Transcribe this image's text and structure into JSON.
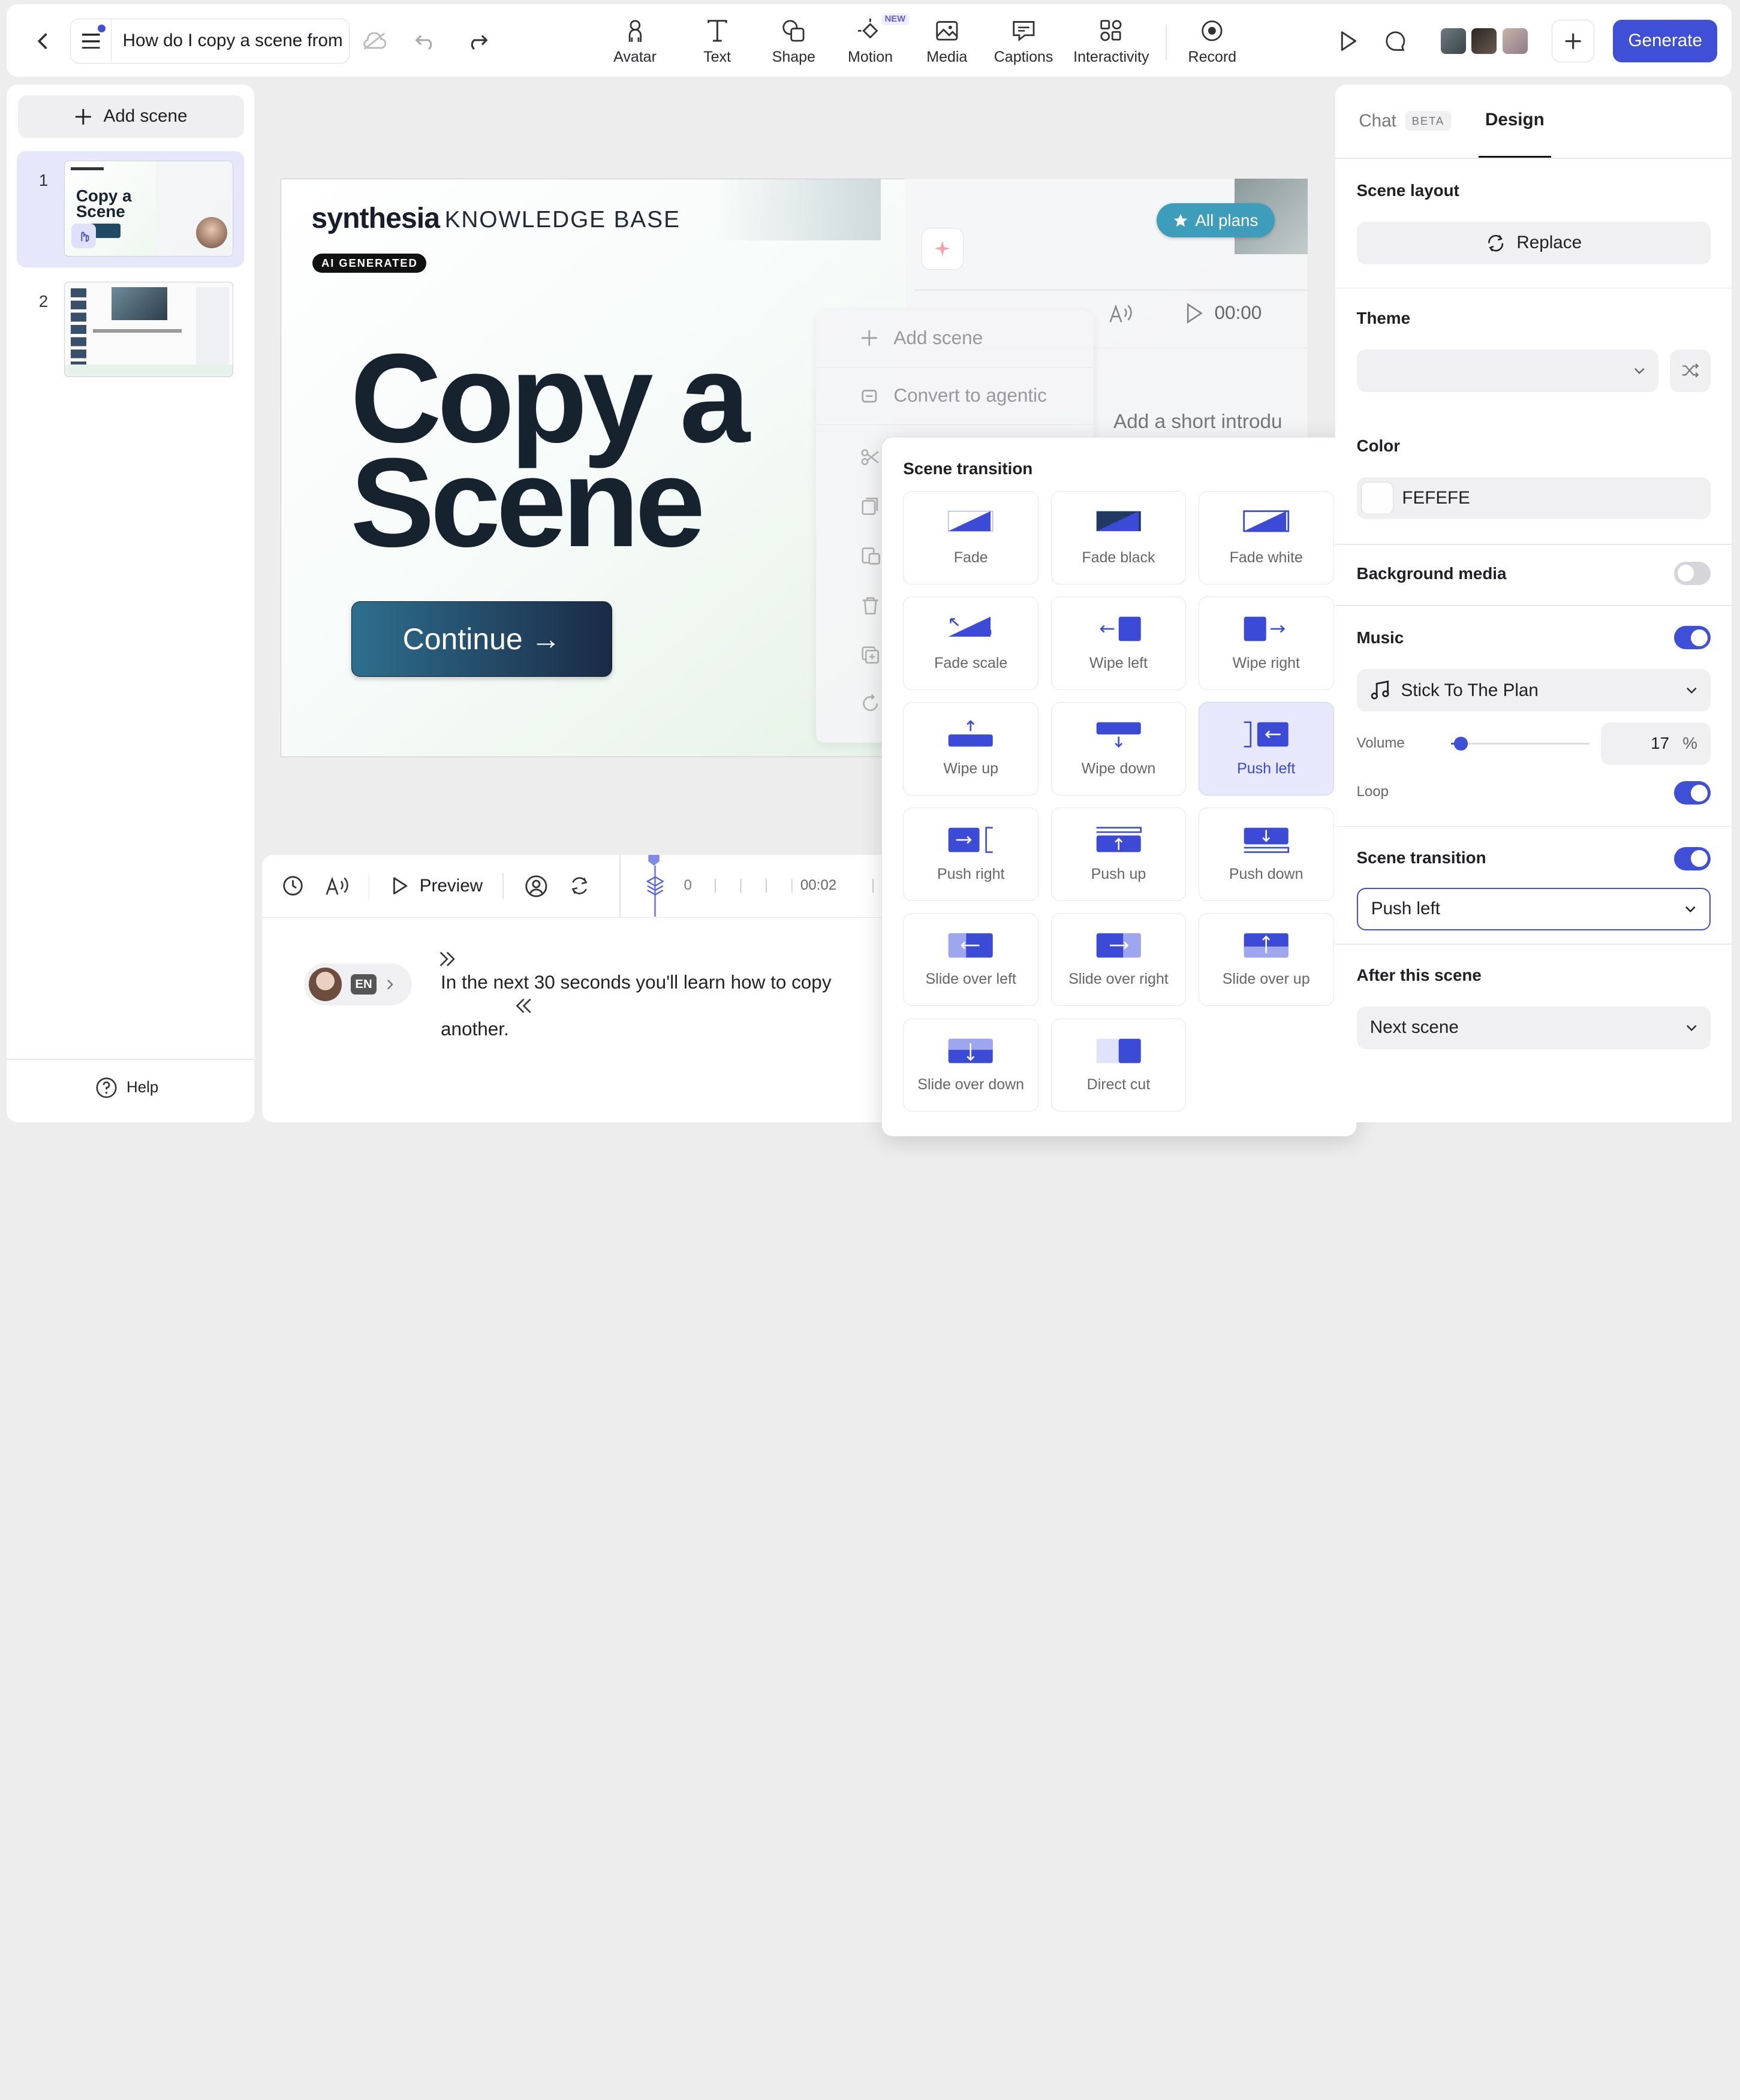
{
  "header": {
    "doc_title": "How do I copy a scene from",
    "tools": [
      {
        "label": "Avatar",
        "icon": "avatar-icon"
      },
      {
        "label": "Text",
        "icon": "text-icon"
      },
      {
        "label": "Shape",
        "icon": "shape-icon"
      },
      {
        "label": "Motion",
        "icon": "motion-icon"
      },
      {
        "label": "Media",
        "icon": "media-icon"
      },
      {
        "label": "Captions",
        "icon": "captions-icon"
      },
      {
        "label": "Interactivity",
        "icon": "interactivity-icon"
      },
      {
        "label": "Record",
        "icon": "record-icon"
      }
    ],
    "new_badge": "NEW",
    "generate_label": "Generate"
  },
  "left_panel": {
    "add_scene_label": "Add scene",
    "scenes": [
      {
        "number": "1"
      },
      {
        "number": "2"
      }
    ],
    "thumb1_title": "Copy a Scene",
    "help_label": "Help"
  },
  "canvas": {
    "brand_name": "synthesia",
    "brand_sub": "KNOWLEDGE BASE",
    "ai_badge": "AI GENERATED",
    "hero_line1": "Copy a",
    "hero_line2": "Scene",
    "continue_label": "Continue →",
    "all_plans_label": "All plans",
    "ghost_time": "00:00",
    "ghost_script": "Add a short introdu"
  },
  "context_menu": {
    "items": [
      {
        "label": "Add scene",
        "icon": "plus-icon"
      },
      {
        "label": "Convert to agentic",
        "icon": "convert-icon"
      }
    ]
  },
  "transitions": {
    "title": "Scene transition",
    "options": [
      {
        "label": "Fade"
      },
      {
        "label": "Fade black"
      },
      {
        "label": "Fade white"
      },
      {
        "label": "Fade scale"
      },
      {
        "label": "Wipe left"
      },
      {
        "label": "Wipe right"
      },
      {
        "label": "Wipe up"
      },
      {
        "label": "Wipe down"
      },
      {
        "label": "Push left"
      },
      {
        "label": "Push right"
      },
      {
        "label": "Push up"
      },
      {
        "label": "Push down"
      },
      {
        "label": "Slide over left"
      },
      {
        "label": "Slide over right"
      },
      {
        "label": "Slide over up"
      },
      {
        "label": "Slide over down"
      },
      {
        "label": "Direct cut"
      }
    ],
    "selected": "Push left"
  },
  "timeline": {
    "preview_label": "Preview",
    "tick0": "0",
    "time_label": "00:02",
    "lang": "EN",
    "script_line1": "In the next 30 seconds you'll learn how to copy",
    "script_line2": "another."
  },
  "right_panel": {
    "tabs": [
      {
        "label": "Chat",
        "badge": "BETA"
      },
      {
        "label": "Design"
      }
    ],
    "active_tab": "Design",
    "scene_layout_label": "Scene layout",
    "replace_label": "Replace",
    "theme_label": "Theme",
    "color_label": "Color",
    "color_value": "FEFEFE",
    "background_media_label": "Background media",
    "background_media_on": false,
    "music_label": "Music",
    "music_on": true,
    "music_track": "Stick To The Plan",
    "volume_label": "Volume",
    "volume_value": "17",
    "volume_unit": "%",
    "loop_label": "Loop",
    "loop_on": true,
    "scene_transition_label": "Scene transition",
    "scene_transition_on": true,
    "scene_transition_value": "Push left",
    "after_scene_label": "After this scene",
    "after_scene_value": "Next scene"
  },
  "colors": {
    "accent": "#3f4fd6",
    "transition_icon": "#3c4bd6",
    "selected_bg": "#e7e8fb"
  }
}
